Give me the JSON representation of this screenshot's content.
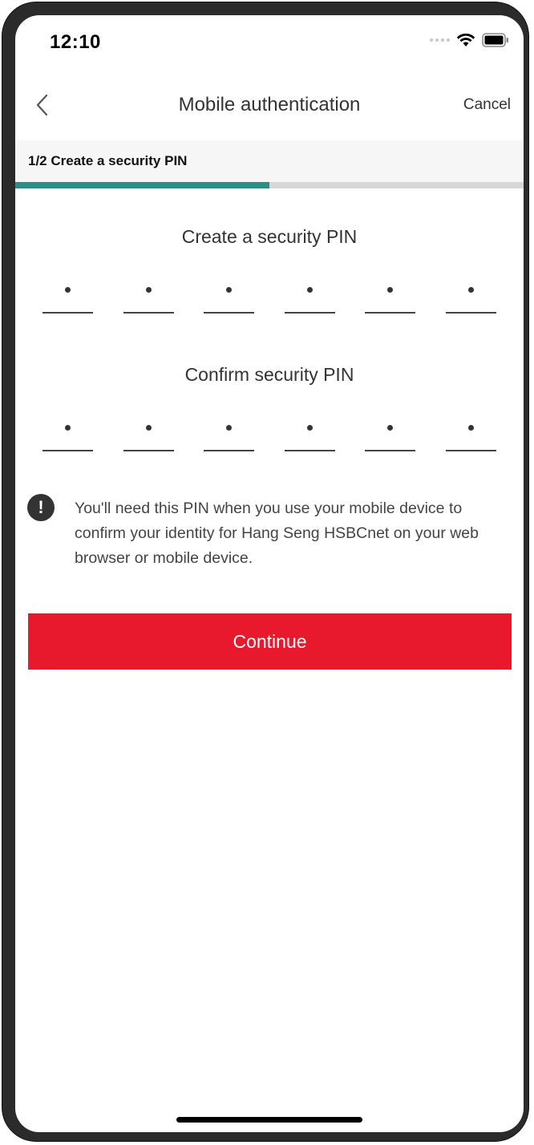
{
  "status_bar": {
    "time": "12:10",
    "wifi_icon": "wifi-icon",
    "battery_icon": "battery-icon"
  },
  "nav": {
    "back_icon": "chevron-left-icon",
    "title": "Mobile authentication",
    "cancel_label": "Cancel"
  },
  "step": {
    "label": "1/2 Create a security PIN",
    "progress": 0.5,
    "progress_color": "#2b8f86"
  },
  "create_pin": {
    "title": "Create a security PIN",
    "digits_entered": 6,
    "length": 6
  },
  "confirm_pin": {
    "title": "Confirm security PIN",
    "digits_entered": 6,
    "length": 6
  },
  "info": {
    "icon": "exclamation-circle-icon",
    "text": "You'll need this PIN when you use your mobile device to confirm your identity for Hang Seng HSBCnet on your web browser or mobile device."
  },
  "continue_button": {
    "label": "Continue",
    "color": "#e8192c"
  }
}
